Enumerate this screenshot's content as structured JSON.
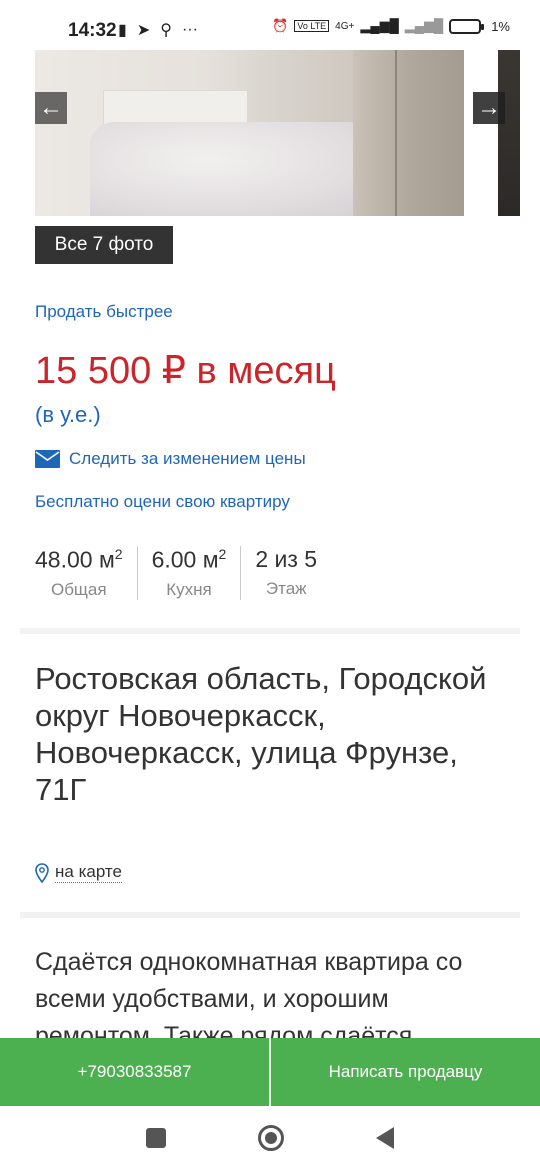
{
  "status_bar": {
    "time": "14:32",
    "network": "4G+",
    "battery": "1%"
  },
  "gallery": {
    "all_photos_label": "Все 7 фото"
  },
  "sell_faster": "Продать быстрее",
  "price": "15 500 ₽ в месяц",
  "price_currency": "(в у.е.)",
  "follow_price": "Следить за изменением цены",
  "estimate": "Бесплатно оцени свою квартиру",
  "stats": [
    {
      "value": "48.00 м",
      "sup": "2",
      "label": "Общая"
    },
    {
      "value": "6.00 м",
      "sup": "2",
      "label": "Кухня"
    },
    {
      "value": "2 из 5",
      "sup": "",
      "label": "Этаж"
    }
  ],
  "address": "Ростовская область, Городской округ Новочеркасск, Новочеркасск, улица Фрунзе, 71Г",
  "map_link": "на карте",
  "description": "Сдаётся однокомнатная квартира со всеми удобствами, и хорошим ремонтом. Также рядом сдаётся",
  "bottom_bar": {
    "phone": "+79030833587",
    "write_label": "Написать продавцу"
  },
  "colors": {
    "price": "#c9252b",
    "link": "#1f66b8",
    "action_green": "#4caf50"
  }
}
